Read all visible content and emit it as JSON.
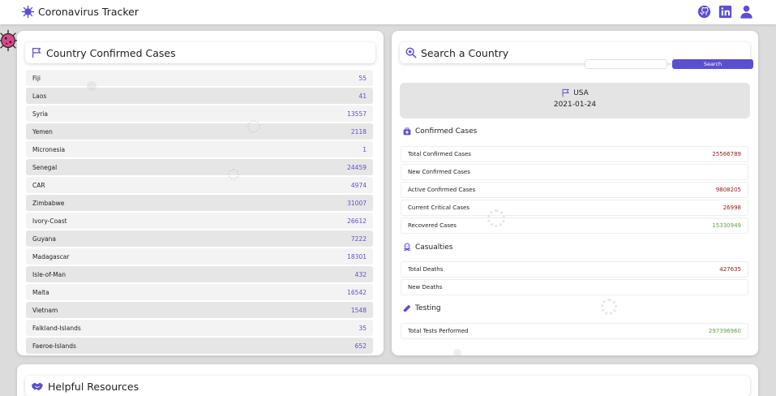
{
  "header": {
    "title": "Coronavirus Tracker",
    "icons": [
      "virus-logo-icon",
      "github-icon",
      "linkedin-icon",
      "user-icon"
    ]
  },
  "colors": {
    "accent": "#5b4fd1",
    "red_value": "#8b1a1a",
    "green_value": "#6a9a4a"
  },
  "left_panel": {
    "title": "Country Confirmed Cases",
    "countries": [
      {
        "name": "Fiji",
        "value": "55"
      },
      {
        "name": "Laos",
        "value": "41"
      },
      {
        "name": "Syria",
        "value": "13557"
      },
      {
        "name": "Yemen",
        "value": "2118"
      },
      {
        "name": "Micronesia",
        "value": "1"
      },
      {
        "name": "Senegal",
        "value": "24459"
      },
      {
        "name": "CAR",
        "value": "4974"
      },
      {
        "name": "Zimbabwe",
        "value": "31007"
      },
      {
        "name": "Ivory-Coast",
        "value": "26612"
      },
      {
        "name": "Guyana",
        "value": "7222"
      },
      {
        "name": "Madagascar",
        "value": "18301"
      },
      {
        "name": "Isle-of-Man",
        "value": "432"
      },
      {
        "name": "Malta",
        "value": "16542"
      },
      {
        "name": "Vietnam",
        "value": "1548"
      },
      {
        "name": "Falkland-Islands",
        "value": "35"
      },
      {
        "name": "Faeroe-Islands",
        "value": "652"
      }
    ]
  },
  "right_panel": {
    "title": "Search a Country",
    "search": {
      "value": "",
      "button_label": "Search"
    },
    "country": {
      "name": "USA",
      "date": "2021-01-24"
    },
    "confirmed": {
      "title": "Confirmed Cases",
      "rows": [
        {
          "label": "Total Confirmed Cases",
          "value": "25566789"
        },
        {
          "label": "New Confirmed Cases",
          "value": ""
        },
        {
          "label": "Active Confirmed Cases",
          "value": "9808205"
        },
        {
          "label": "Current Critical Cases",
          "value": "26998"
        },
        {
          "label": "Recovered Cases",
          "value": "15330949"
        }
      ]
    },
    "casualties": {
      "title": "Casualties",
      "rows": [
        {
          "label": "Total Deaths",
          "value": "427635"
        },
        {
          "label": "New Deaths",
          "value": ""
        }
      ]
    },
    "testing": {
      "title": "Testing",
      "rows": [
        {
          "label": "Total Tests Performed",
          "value": "297396960"
        }
      ]
    }
  },
  "bottom_panel": {
    "title": "Helpful Resources"
  }
}
